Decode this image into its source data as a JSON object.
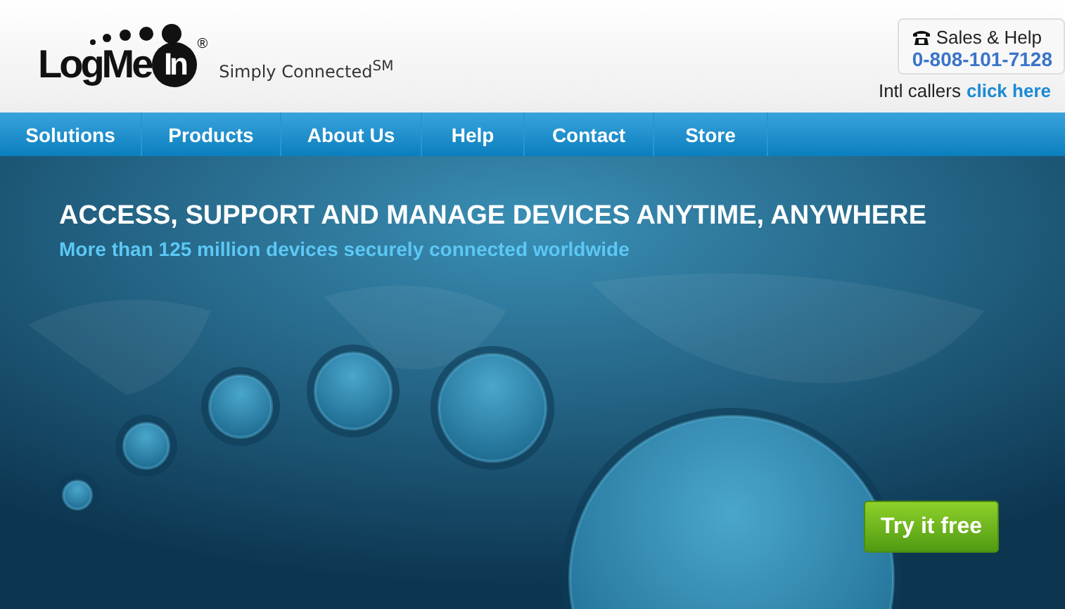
{
  "header": {
    "logo": {
      "text": "LogMe",
      "badge": "In",
      "registered": "®"
    },
    "tagline": "Simply Connected$^{SM}$",
    "sales": {
      "label": "Sales & Help",
      "phone": "0-808-101-7128"
    },
    "intl": {
      "text": "Intl callers",
      "link": "click here"
    }
  },
  "nav": {
    "items": [
      "Solutions",
      "Products",
      "About Us",
      "Help",
      "Contact",
      "Store"
    ]
  },
  "hero": {
    "headline": "ACCESS, SUPPORT AND MANAGE DEVICES ANYTIME, ANYWHERE",
    "subline": "More than 125 million devices securely connected worldwide",
    "button": "Try it free"
  }
}
